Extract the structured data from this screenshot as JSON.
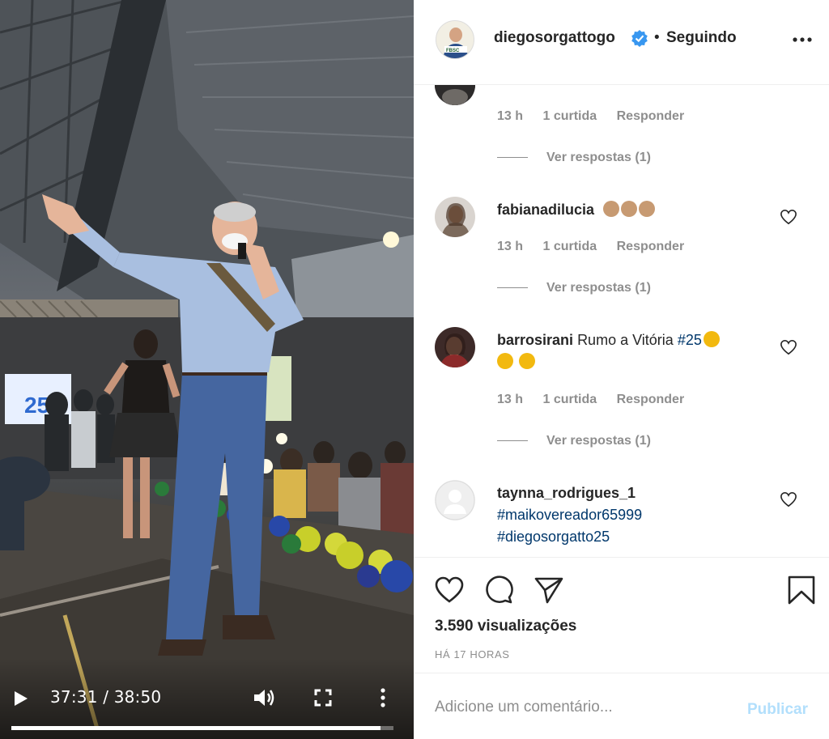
{
  "video": {
    "current_time": "37:31",
    "separator": " / ",
    "duration": "38:50",
    "progress_fraction": 0.966,
    "banner_text": "25",
    "icons": {
      "play": "play-icon",
      "volume": "volume-icon",
      "fullscreen": "fullscreen-icon",
      "more": "more-vertical-icon"
    }
  },
  "post": {
    "username": "diegosorgattogo",
    "separator": "•",
    "follow_status": "Seguindo",
    "avatar_badge": "FBSC",
    "icons": {
      "verified": "verified-badge-icon",
      "more": "more-horizontal-icon"
    }
  },
  "comments": [
    {
      "username": "",
      "text": "",
      "time": "13 h",
      "likes": "1 curtida",
      "reply_label": "Responder",
      "view_replies": "Ver respostas (1)"
    },
    {
      "username": "fabianadilucia",
      "text": "",
      "emojis": [
        "clap-emoji",
        "clap-emoji",
        "clap-emoji"
      ],
      "time": "13 h",
      "likes": "1 curtida",
      "reply_label": "Responder",
      "view_replies": "Ver respostas (1)"
    },
    {
      "username": "barrosirani",
      "text": "Rumo a Vitória",
      "hashtag": "#25",
      "emojis": [
        "clap-emoji",
        "clap-emoji",
        "pray-emoji"
      ],
      "time": "13 h",
      "likes": "1 curtida",
      "reply_label": "Responder",
      "view_replies": "Ver respostas (1)"
    },
    {
      "username": "taynna_rodrigues_1",
      "hashtags": [
        "#maikovereador65999",
        "#diegosorgatto25"
      ]
    }
  ],
  "actions": {
    "views": "3.590 visualizações",
    "timestamp": "HÁ 17 HORAS",
    "icons": {
      "like": "heart-icon",
      "comment": "comment-icon",
      "share": "send-icon",
      "save": "bookmark-icon"
    }
  },
  "composer": {
    "placeholder": "Adicione um comentário...",
    "value": "",
    "publish_label": "Publicar"
  },
  "colors": {
    "link": "#00376b",
    "muted": "#8e8e8e",
    "verified": "#3897f0",
    "publish_disabled": "#b2dffc",
    "text": "#262626"
  }
}
